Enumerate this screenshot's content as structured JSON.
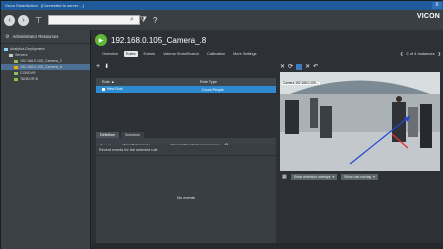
{
  "window": {
    "title": "Vicon SmartAction",
    "subtitle": "(Connected to server ...)",
    "close_label": "X"
  },
  "toolbar": {
    "search_placeholder": "",
    "filter_icon": "filter-icon",
    "help_icon": "help-icon",
    "logo": "VICON"
  },
  "sidebar": {
    "header": "Administrator Resources",
    "items": [
      {
        "label": "Analytics Deployment"
      },
      {
        "label": "Servers"
      },
      {
        "label": "192.168.0.105_Camera_2"
      },
      {
        "label": "192.168.0.105_Camera_8"
      },
      {
        "label": "CONDVR"
      },
      {
        "label": "TANDVR B"
      }
    ]
  },
  "camera": {
    "title": "192.168.0.105_Camera_.8"
  },
  "tabs": [
    {
      "label": "Overview"
    },
    {
      "label": "Rules"
    },
    {
      "label": "Events"
    },
    {
      "label": "Valerus SmartSearch"
    },
    {
      "label": "Calibration"
    },
    {
      "label": "More Settings"
    }
  ],
  "pager": {
    "text": "2 of 4 Instances"
  },
  "rules": {
    "headers": [
      "Rule ▲",
      "Rule Type"
    ],
    "rows": [
      {
        "name": "New Rule",
        "type": "Count People"
      }
    ]
  },
  "settings": {
    "tabs": [
      "Definition",
      "Schedule"
    ],
    "rule_name_label": "Rule Name:",
    "rule_name_value": "New Rule",
    "sensitivity_label": "Normal Sensitivity",
    "min_distance_label": "Define Min distance:",
    "min_distance_value": "1.0",
    "min_distance_unit": "feet"
  },
  "events": {
    "header": "Recent events for the selected rule",
    "empty": "No events"
  },
  "video": {
    "overlay_text": "Camera 192.168.0.105 ...",
    "detection_button": "Show detection overlays",
    "rule_button": "Show rule overlay"
  }
}
